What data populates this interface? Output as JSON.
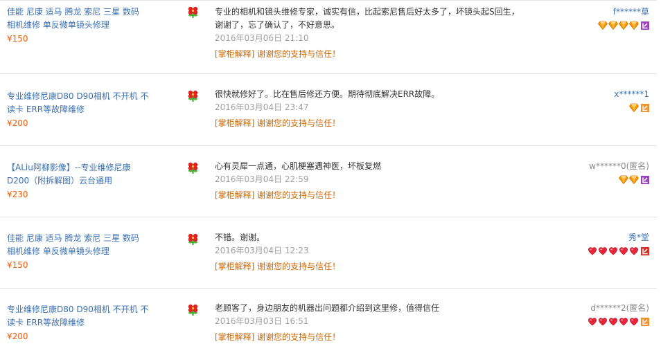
{
  "reviews": [
    {
      "product": "佳能 尼康 适马 腾龙 索尼 三星 数码相机维修 单反微单镜头修理",
      "price": "¥150",
      "text": "专业的相机和镜头维修专家，诚实有信，比起索尼售后好太多了，坏镜头起S回生，谢谢了，忘了确认了，不好意思。",
      "date": "2016年03月06日 21:10",
      "reply": "[掌柜解释] 谢谢您的支持与信任！",
      "user": "f******草",
      "badge_type": "diamond",
      "badge_count": 4,
      "vip": "vip-purple"
    },
    {
      "product": "专业维修尼康D80 D90相机 不开机 不读卡 ERR等故障维修",
      "price": "¥200",
      "text": "很快就修好了。比在售后修还方便。期待彻底解决ERR故障。",
      "date": "2016年03月04日 23:47",
      "reply": "[掌柜解释] 谢谢您的支持与信任！",
      "user": "x******1",
      "badge_type": "diamond",
      "badge_count": 1,
      "vip": "vip-orange"
    },
    {
      "product": "【ALiu阿柳影像】--专业维修尼康D200（附拆解图）云台通用",
      "price": "¥230",
      "text": "心有灵犀一点通，心肌梗塞遇神医，坏板复燃",
      "date": "2016年03月04日 22:59",
      "reply": "[掌柜解释] 谢谢您的支持与信任！",
      "user": "w******0(匿名)",
      "anonymous": true,
      "badge_type": "diamond",
      "badge_count": 2,
      "vip": "vip-purple"
    },
    {
      "product": "佳能 尼康 适马 腾龙 索尼 三星 数码相机维修 单反微单镜头修理",
      "price": "¥150",
      "text": "不错。谢谢。",
      "date": "2016年03月04日 12:23",
      "reply": "[掌柜解释] 谢谢您的支持与信任！",
      "user": "秀*堂",
      "badge_type": "heart",
      "badge_count": 5,
      "vip": "vip-red"
    },
    {
      "product": "专业维修尼康D80 D90相机 不开机 不读卡 ERR等故障维修",
      "price": "¥200",
      "text": "老顾客了，身边朋友的机器出问题都介绍到这里修，值得信任",
      "date": "2016年03月03日 16:51",
      "reply": "[掌柜解释] 谢谢您的支持与信任！",
      "user": "d******2(匿名)",
      "anonymous": true,
      "badge_type": "heart",
      "badge_count": 5,
      "vip": "vip-orange"
    }
  ],
  "colors": {
    "link": "#3a6fb0",
    "price": "#f05a00",
    "reply": "#cc6600",
    "date": "#a0a0a0",
    "diamond": "#f39800",
    "heart": "#e8263b",
    "vip-purple": "#9b3fbf",
    "vip-orange": "#f0902a",
    "vip-red": "#d93025"
  },
  "icons": {
    "flower": "flower-icon",
    "diamond": "diamond-icon",
    "heart": "heart-icon",
    "vip": "vip-icon"
  }
}
